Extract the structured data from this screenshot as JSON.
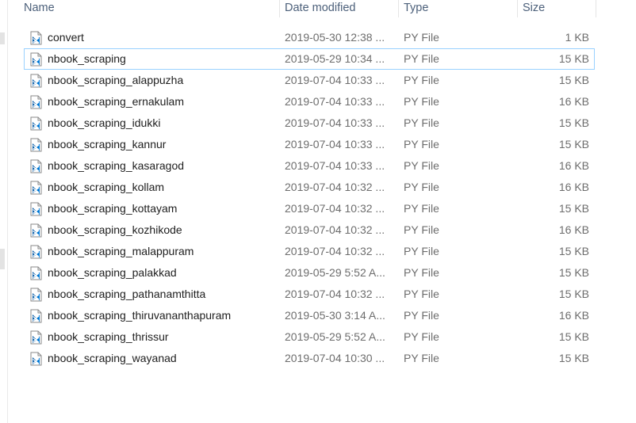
{
  "columns": {
    "name": "Name",
    "date_modified": "Date modified",
    "type": "Type",
    "size": "Size"
  },
  "file_icon": "python-file-icon",
  "colors": {
    "header_text": "#4c607a",
    "focus_border": "#99d1ff",
    "icon_blue": "#0078d4",
    "secondary_text": "#6d6d6d"
  },
  "files": [
    {
      "name": "convert",
      "date": "2019-05-30 12:38 ...",
      "type": "PY File",
      "size": "1 KB"
    },
    {
      "name": "nbook_scraping",
      "date": "2019-05-29 10:34 ...",
      "type": "PY File",
      "size": "15 KB"
    },
    {
      "name": "nbook_scraping_alappuzha",
      "date": "2019-07-04 10:33 ...",
      "type": "PY File",
      "size": "15 KB"
    },
    {
      "name": "nbook_scraping_ernakulam",
      "date": "2019-07-04 10:33 ...",
      "type": "PY File",
      "size": "16 KB"
    },
    {
      "name": "nbook_scraping_idukki",
      "date": "2019-07-04 10:33 ...",
      "type": "PY File",
      "size": "15 KB"
    },
    {
      "name": "nbook_scraping_kannur",
      "date": "2019-07-04 10:33 ...",
      "type": "PY File",
      "size": "15 KB"
    },
    {
      "name": "nbook_scraping_kasaragod",
      "date": "2019-07-04 10:33 ...",
      "type": "PY File",
      "size": "16 KB"
    },
    {
      "name": "nbook_scraping_kollam",
      "date": "2019-07-04 10:32 ...",
      "type": "PY File",
      "size": "16 KB"
    },
    {
      "name": "nbook_scraping_kottayam",
      "date": "2019-07-04 10:32 ...",
      "type": "PY File",
      "size": "15 KB"
    },
    {
      "name": "nbook_scraping_kozhikode",
      "date": "2019-07-04 10:32 ...",
      "type": "PY File",
      "size": "16 KB"
    },
    {
      "name": "nbook_scraping_malappuram",
      "date": "2019-07-04 10:32 ...",
      "type": "PY File",
      "size": "15 KB"
    },
    {
      "name": "nbook_scraping_palakkad",
      "date": "2019-05-29 5:52 A...",
      "type": "PY File",
      "size": "15 KB"
    },
    {
      "name": "nbook_scraping_pathanamthitta",
      "date": "2019-07-04 10:32 ...",
      "type": "PY File",
      "size": "15 KB"
    },
    {
      "name": "nbook_scraping_thiruvananthapuram",
      "date": "2019-05-30 3:14 A...",
      "type": "PY File",
      "size": "16 KB"
    },
    {
      "name": "nbook_scraping_thrissur",
      "date": "2019-05-29 5:52 A...",
      "type": "PY File",
      "size": "15 KB"
    },
    {
      "name": "nbook_scraping_wayanad",
      "date": "2019-07-04 10:30 ...",
      "type": "PY File",
      "size": "15 KB"
    }
  ]
}
